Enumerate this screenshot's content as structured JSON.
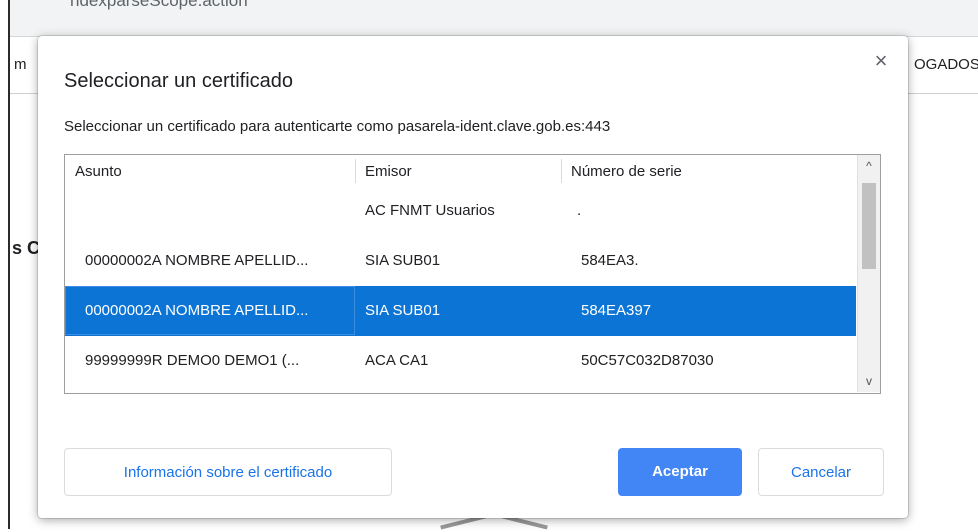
{
  "background": {
    "url_fragment": "ndexparseScope.action",
    "nav_left": "m",
    "nav_right": "OGADOS",
    "heading_fragment": "s C"
  },
  "dialog": {
    "title": "Seleccionar un certificado",
    "subtitle": "Seleccionar un certificado para autenticarte como pasarela-ident.clave.gob.es:443",
    "close_icon": "×",
    "table": {
      "columns": [
        "Asunto",
        "Emisor",
        "Número de serie"
      ],
      "rows": [
        {
          "asunto": "",
          "emisor": "AC FNMT Usuarios",
          "serie": "."
        },
        {
          "asunto": "00000002A NOMBRE APELLID...",
          "emisor": "SIA SUB01",
          "serie": "584EA3."
        },
        {
          "asunto": "00000002A NOMBRE APELLID...",
          "emisor": "SIA SUB01",
          "serie": "584EA397"
        },
        {
          "asunto": "99999999R DEMO0 DEMO1 (...",
          "emisor": "ACA CA1",
          "serie": "50C57C032D87030"
        }
      ],
      "selected_row": 2,
      "scroll_up_icon": "^",
      "scroll_down_icon": "v"
    },
    "buttons": {
      "info": "Información sobre el certificado",
      "accept": "Aceptar",
      "cancel": "Cancelar"
    }
  },
  "colors": {
    "selection": "#0b74d4",
    "primary_button": "#4285f4",
    "link_text": "#1a73e8"
  }
}
